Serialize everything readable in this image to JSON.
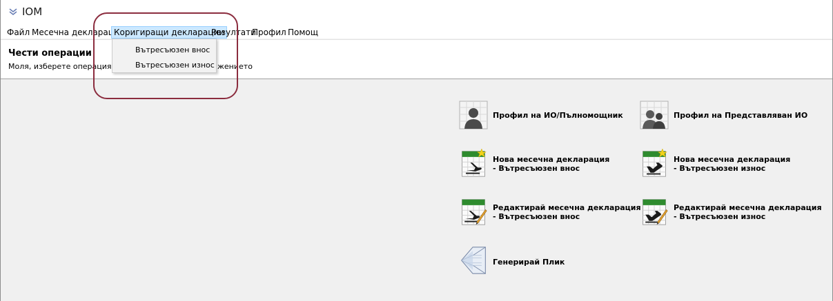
{
  "window": {
    "title": "IOM"
  },
  "menu": {
    "items": [
      "Файл",
      "Месечна декларация",
      "Коригиращи декларации",
      "Резултати",
      "Профил",
      "Помощ"
    ],
    "active_index": 2
  },
  "dropdown": {
    "items": [
      "Вътресъюзен внос",
      "Вътресъюзен износ"
    ]
  },
  "header": {
    "title": "Чести операции",
    "subtitle_left": "Моля, изберете операция или",
    "subtitle_right": "жението"
  },
  "operations": {
    "profile_io": {
      "line1": "Профил на ИО/Пълномощник",
      "icon": "person-profile-icon"
    },
    "profile_represented": {
      "line1": "Профил на Представляван ИО",
      "icon": "group-profile-icon"
    },
    "new_import": {
      "line1": "Нова месечна декларация",
      "line2": "- Вътресъюзен внос",
      "icon": "new-declaration-import-icon"
    },
    "new_export": {
      "line1": "Нова месечна декларация",
      "line2": "- Вътресъюзен износ",
      "icon": "new-declaration-export-icon"
    },
    "edit_import": {
      "line1": "Редактирай месечна декларация",
      "line2": "- Вътресъюзен внос",
      "icon": "edit-declaration-import-icon"
    },
    "edit_export": {
      "line1": "Редактирай месечна декларация",
      "line2": "- Вътресъюзен износ",
      "icon": "edit-declaration-export-icon"
    },
    "envelope": {
      "line1": "Генерирай Плик",
      "icon": "envelope-icon"
    }
  },
  "colors": {
    "menu_highlight": "#cce8ff",
    "annotation_ring": "#8b2c3e",
    "calendar_green": "#2e8b2e"
  }
}
